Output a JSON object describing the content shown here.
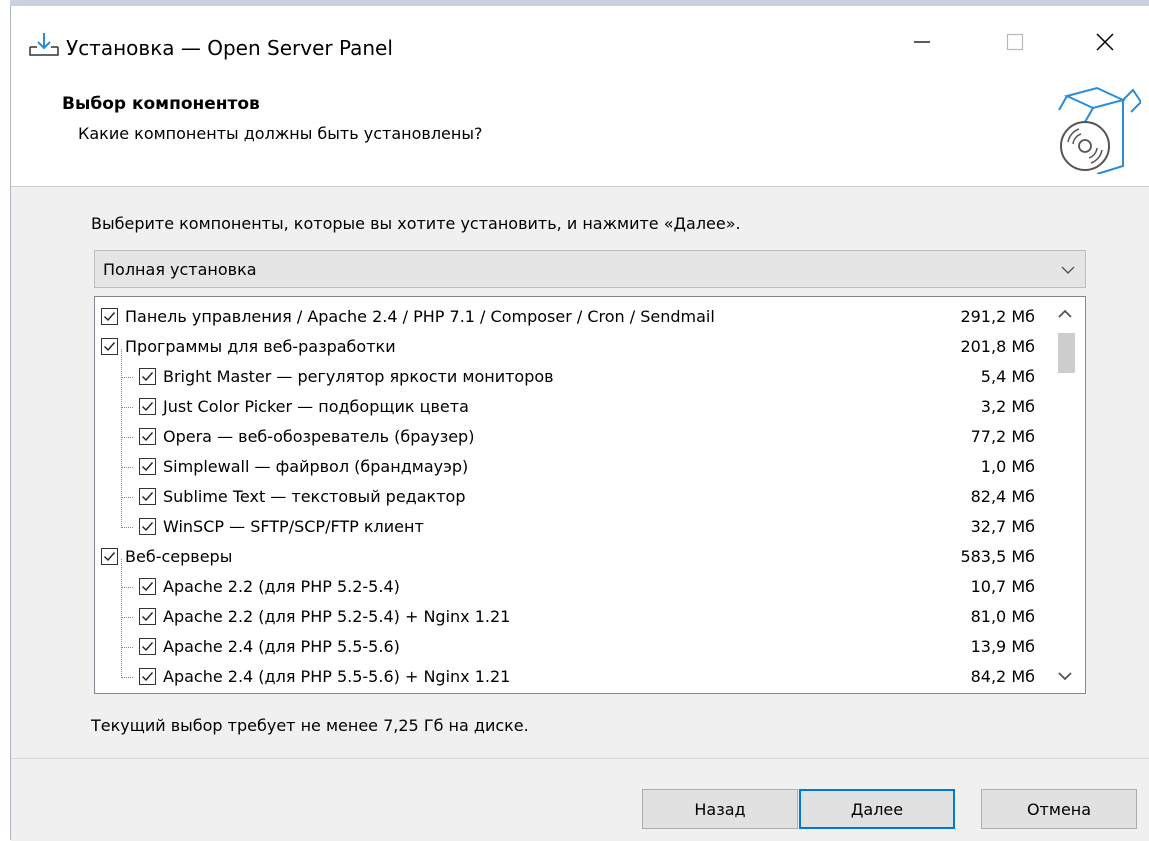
{
  "window": {
    "title": "Установка — Open Server Panel"
  },
  "header": {
    "title": "Выбор компонентов",
    "subtitle": "Какие компоненты должны быть установлены?"
  },
  "instruction": "Выберите компоненты, которые вы хотите установить, и нажмите «Далее».",
  "install_type": {
    "selected": "Полная установка"
  },
  "components": [
    {
      "label": "Панель управления / Apache 2.4 / PHP 7.1 / Composer / Cron / Sendmail",
      "size": "291,2 Мб",
      "checked": true,
      "level": 0
    },
    {
      "label": "Программы для веб-разработки",
      "size": "201,8 Мб",
      "checked": true,
      "level": 0
    },
    {
      "label": "Bright Master — регулятор яркости мониторов",
      "size": "5,4 Мб",
      "checked": true,
      "level": 1
    },
    {
      "label": "Just Color Picker — подборщик цвета",
      "size": "3,2 Мб",
      "checked": true,
      "level": 1
    },
    {
      "label": "Opera — веб-обозреватель (браузер)",
      "size": "77,2 Мб",
      "checked": true,
      "level": 1
    },
    {
      "label": "Simplewall — файрвол (брандмауэр)",
      "size": "1,0 Мб",
      "checked": true,
      "level": 1
    },
    {
      "label": "Sublime Text — текстовый редактор",
      "size": "82,4 Мб",
      "checked": true,
      "level": 1
    },
    {
      "label": "WinSCP — SFTP/SCP/FTP клиент",
      "size": "32,7 Мб",
      "checked": true,
      "level": 1
    },
    {
      "label": "Веб-серверы",
      "size": "583,5 Мб",
      "checked": true,
      "level": 0
    },
    {
      "label": "Apache 2.2 (для PHP 5.2-5.4)",
      "size": "10,7 Мб",
      "checked": true,
      "level": 1
    },
    {
      "label": "Apache 2.2 (для PHP 5.2-5.4) + Nginx 1.21",
      "size": "81,0 Мб",
      "checked": true,
      "level": 1
    },
    {
      "label": "Apache 2.4 (для PHP 5.5-5.6)",
      "size": "13,9 Мб",
      "checked": true,
      "level": 1
    },
    {
      "label": "Apache 2.4 (для PHP 5.5-5.6) + Nginx 1.21",
      "size": "84,2 Мб",
      "checked": true,
      "level": 1
    }
  ],
  "disk_info": "Текущий выбор требует не менее 7,25 Гб на диске.",
  "buttons": {
    "back": "Назад",
    "next": "Далее",
    "cancel": "Отмена"
  },
  "colors": {
    "accent": "#0078d7",
    "icon_blue": "#2b8bd9"
  },
  "icons": {
    "app": "download-icon",
    "header": "box-disc-icon"
  }
}
